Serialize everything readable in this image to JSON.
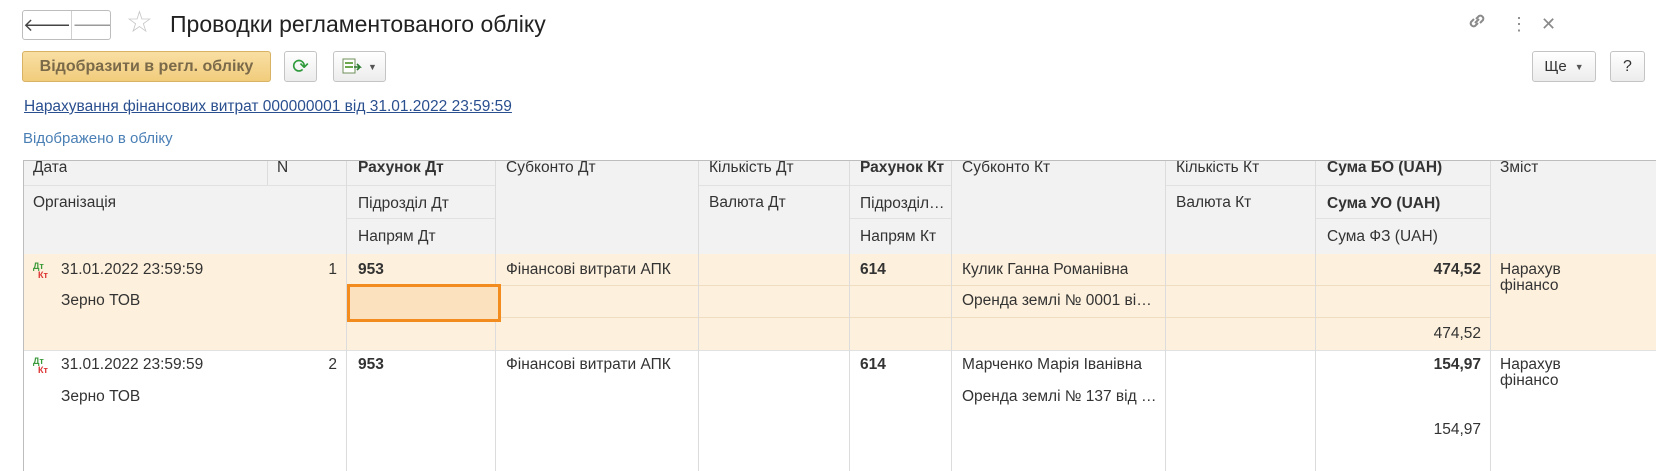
{
  "window": {
    "title": "Проводки регламентованого обліку",
    "back_icon": "arrow-left-icon",
    "forward_icon": "arrow-right-icon",
    "favorite_icon": "star-icon",
    "link_icon": "link-icon",
    "menu_icon": "more-vertical-icon",
    "close_icon": "close-icon"
  },
  "toolbar": {
    "post_label": "Відобразити в регл. обліку",
    "refresh_icon": "refresh-icon",
    "export_icon": "excel-export-icon",
    "more_label": "Ще",
    "help_label": "?"
  },
  "document_link": "Нарахування фінансових витрат 000000001 від 31.01.2022 23:59:59",
  "status_text": "Відображено в обліку",
  "table": {
    "headers": {
      "date": "Дата",
      "n": "N",
      "organization": "Організація",
      "acc_dt": "Рахунок Дт",
      "dept_dt": "Підрозділ Дт",
      "dir_dt": "Напрям Дт",
      "subkonto_dt": "Субконто Дт",
      "qty_dt": "Кількість Дт",
      "currency_dt": "Валюта Дт",
      "acc_kt": "Рахунок Кт",
      "dept_kt": "Підрозділ…",
      "dir_kt": "Напрям Кт",
      "subkonto_kt": "Субконто Кт",
      "qty_kt": "Кількість Кт",
      "currency_kt": "Валюта Кт",
      "sum_bo": "Сума БО (UAH)",
      "sum_uo": "Сума УО (UAH)",
      "sum_fz": "Сума ФЗ (UAH)",
      "content": "Зміст"
    },
    "rows": [
      {
        "icon_dt": "Дт",
        "icon_kt": "Кт",
        "date": "31.01.2022 23:59:59",
        "n": "1",
        "organization": "Зерно ТОВ",
        "acc_dt": "953",
        "subkonto_dt": "Фінансові витрати АПК",
        "acc_kt": "614",
        "subkonto_kt_1": "Кулик Ганна Романівна",
        "subkonto_kt_2": "Оренда землі № 0001 від…",
        "sum_bo": "474,52",
        "sum_fz": "474,52",
        "content_1": "Нарахув",
        "content_2": "фінансо"
      },
      {
        "icon_dt": "Дт",
        "icon_kt": "Кт",
        "date": "31.01.2022 23:59:59",
        "n": "2",
        "organization": "Зерно ТОВ",
        "acc_dt": "953",
        "subkonto_dt": "Фінансові витрати АПК",
        "acc_kt": "614",
        "subkonto_kt_1": "Марченко Марія Іванівна",
        "subkonto_kt_2": "Оренда землі № 137 від …",
        "sum_bo": "154,97",
        "sum_fz": "154,97",
        "content_1": "Нарахув",
        "content_2": "фінансо"
      }
    ]
  },
  "colors": {
    "selected_row": "#fdf0dc",
    "selected_cell_border": "#f28c1e",
    "header_bg": "#f2f2f2",
    "accent_button": "#f4d28a",
    "link": "#2a4f8f"
  }
}
